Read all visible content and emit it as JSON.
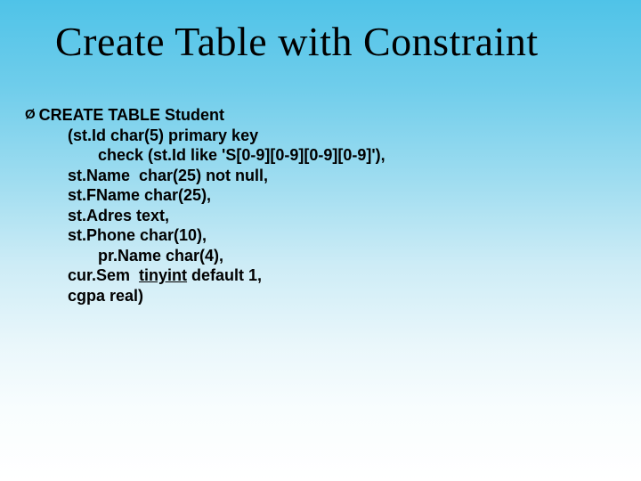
{
  "title": "Create Table with Constraint",
  "bullet_glyph": "Ø",
  "code": {
    "l0": "CREATE TABLE Student",
    "l1": "(st.Id char(5) primary key",
    "l2": "check (st.Id like 'S[0-9][0-9][0-9][0-9]'),",
    "l3": "st.Name  char(25) not null,",
    "l4": "st.FName char(25),",
    "l5": "st.Adres text,",
    "l6": "st.Phone char(10),",
    "l7": "pr.Name char(4),",
    "l8a": "cur.Sem  ",
    "l8b": "tinyint",
    "l8c": " default 1,",
    "l9": "cgpa real)"
  }
}
